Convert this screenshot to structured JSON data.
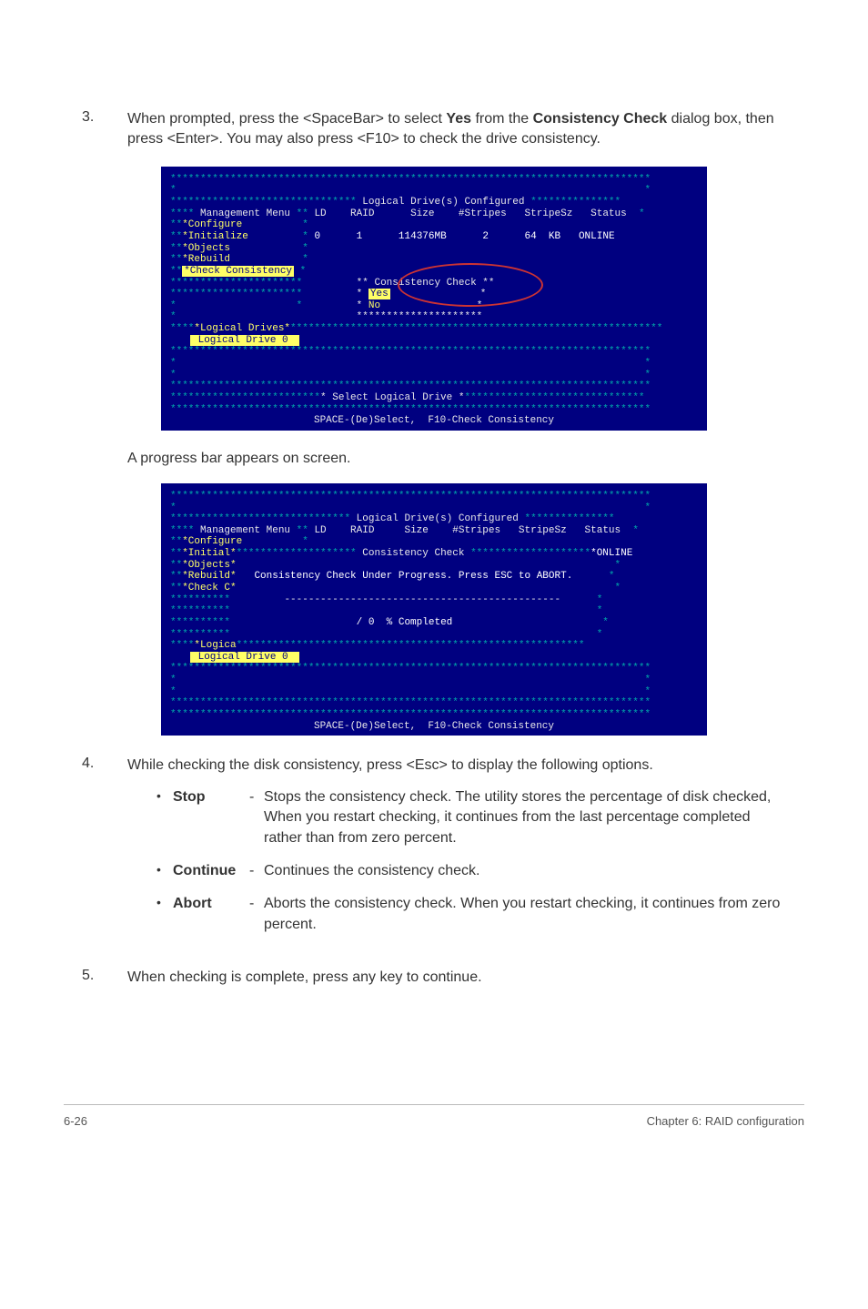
{
  "step3": {
    "num": "3.",
    "text_before_bold1": "When prompted, press the <SpaceBar> to select ",
    "bold1": "Yes",
    "text_mid": " from the ",
    "bold2": "Consistency Check",
    "text_after": " dialog box, then press <Enter>. You may also press <F10> to check the drive consistency."
  },
  "bios1": {
    "headerTitle": " Logical Drive(s) Configured ",
    "menuTitle": " Management Menu ",
    "cols": {
      "ld": "LD",
      "raid": "RAID",
      "size": "Size",
      "stripes": "#Stripes",
      "stripesz": "StripeSz",
      "status": "Status"
    },
    "menu": [
      "*Configure",
      "*Initialize",
      "*Objects",
      "*Rebuild",
      "*Check Consistency"
    ],
    "row": {
      "ld": "0",
      "raid": "1",
      "size": "114376MB",
      "stripes": "2",
      "stripesz": "64  KB",
      "status": "ONLINE"
    },
    "consistTitle": "Consistency Check",
    "yes": "Yes",
    "no": "No",
    "logicalDrives": "*Logical Drives*",
    "selectDrive": " Select Logical Drive ",
    "footer": "SPACE-(De)Select,  F10-Check Consistency"
  },
  "caption1": "A progress bar appears on screen.",
  "bios2": {
    "headerTitle": " Logical Drive(s) Configured ",
    "menuTitle": " Management Menu ",
    "cols": {
      "ld": "LD",
      "raid": "RAID",
      "size": "Size",
      "stripes": "#Stripes",
      "stripesz": "StripeSz",
      "status": "Status"
    },
    "menu": [
      "*Configure",
      "*Initial*",
      "*Objects*",
      "*Rebuild*",
      "*Check C*"
    ],
    "consistCheck": " Consistency Check ",
    "online": "*ONLINE",
    "progressMsg": "Consistency Check Under Progress. Press ESC to ABORT.",
    "progress": " / 0  % Completed",
    "logica": "*Logica",
    "footer": "SPACE-(De)Select,  F10-Check Consistency"
  },
  "step4": {
    "num": "4.",
    "text": "While checking the disk consistency, press <Esc> to display the following options."
  },
  "options": [
    {
      "name": "Stop",
      "sep": "-",
      "desc": "Stops the consistency check. The utility stores the percentage of disk checked, When you restart checking, it continues from the last percentage completed rather than from zero percent."
    },
    {
      "name": "Continue",
      "sep": "-",
      "desc": "Continues the consistency check."
    },
    {
      "name": "Abort",
      "sep": "-",
      "desc": "Aborts the consistency check. When you restart checking, it continues from zero percent."
    }
  ],
  "step5": {
    "num": "5.",
    "text": "When checking is complete, press any key to continue."
  },
  "footer": {
    "left": "6-26",
    "right": "Chapter 6: RAID configuration"
  }
}
